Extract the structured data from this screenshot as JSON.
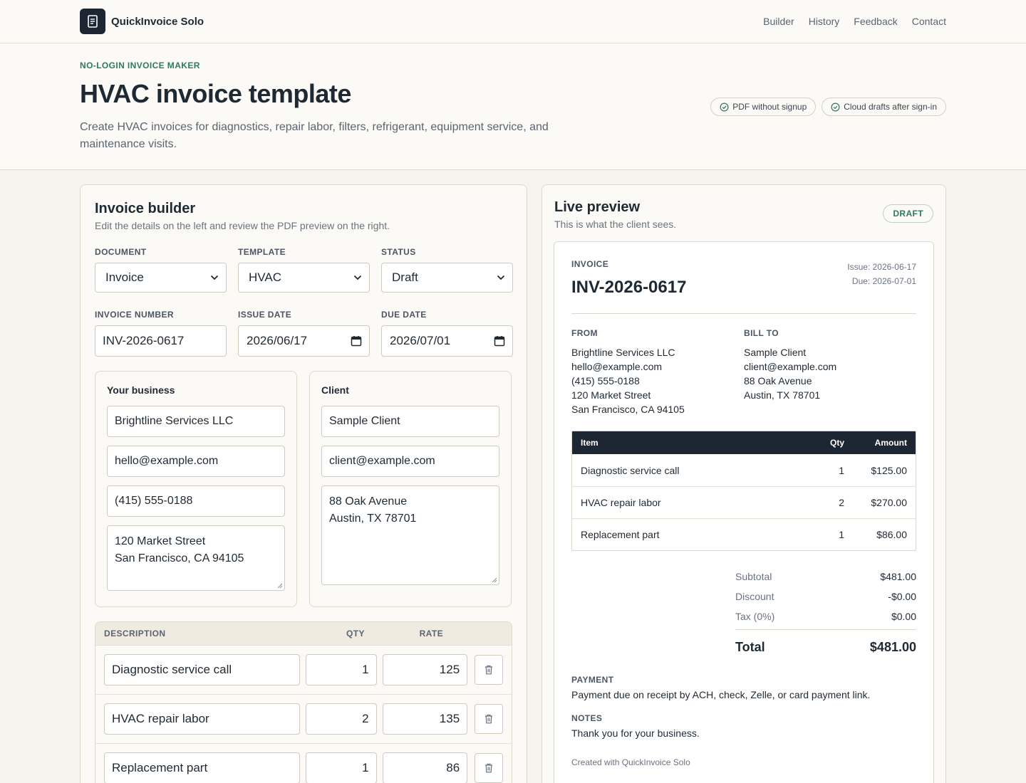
{
  "app": {
    "name": "QuickInvoice Solo"
  },
  "nav": [
    {
      "label": "Builder"
    },
    {
      "label": "History"
    },
    {
      "label": "Feedback"
    },
    {
      "label": "Contact"
    }
  ],
  "hero": {
    "eyebrow": "NO-LOGIN INVOICE MAKER",
    "title": "HVAC invoice template",
    "description": "Create HVAC invoices for diagnostics, repair labor, filters, refrigerant, equipment service, and maintenance visits.",
    "badges": [
      {
        "label": "PDF without signup",
        "icon": "check-circle-icon"
      },
      {
        "label": "Cloud drafts after sign-in",
        "icon": "check-circle-icon"
      }
    ]
  },
  "builder": {
    "title": "Invoice builder",
    "subtitle": "Edit the details on the left and review the PDF preview on the right.",
    "document": {
      "label": "DOCUMENT",
      "value": "Invoice"
    },
    "template": {
      "label": "TEMPLATE",
      "value": "HVAC"
    },
    "status": {
      "label": "STATUS",
      "value": "Draft"
    },
    "invoice_number": {
      "label": "INVOICE NUMBER",
      "value": "INV-2026-0617"
    },
    "issue_date": {
      "label": "ISSUE DATE",
      "value": "2026/06/17"
    },
    "due_date": {
      "label": "DUE DATE",
      "value": "2026/07/01"
    },
    "business": {
      "title": "Your business",
      "name": "Brightline Services LLC",
      "email": "hello@example.com",
      "phone": "(415) 555-0188",
      "address_line1": "120 Market Street",
      "address_line2": "San Francisco, CA 94105"
    },
    "client": {
      "title": "Client",
      "name": "Sample Client",
      "email": "client@example.com",
      "address_line1": "88 Oak Avenue",
      "address_line2": "Austin, TX 78701"
    },
    "items_header": {
      "description": "DESCRIPTION",
      "qty": "QTY",
      "rate": "RATE"
    },
    "items": [
      {
        "description": "Diagnostic service call",
        "qty": "1",
        "rate": "125"
      },
      {
        "description": "HVAC repair labor",
        "qty": "2",
        "rate": "135"
      },
      {
        "description": "Replacement part",
        "qty": "1",
        "rate": "86"
      }
    ]
  },
  "preview": {
    "title": "Live preview",
    "subtitle": "This is what the client sees.",
    "status_badge": "DRAFT",
    "invoice_label": "INVOICE",
    "invoice_number": "INV-2026-0617",
    "issue": "Issue: 2026-06-17",
    "due": "Due: 2026-07-01",
    "from_label": "FROM",
    "from": [
      "Brightline Services LLC",
      "hello@example.com",
      "(415) 555-0188",
      "120 Market Street",
      "San Francisco, CA 94105"
    ],
    "bill_to_label": "BILL TO",
    "bill_to": [
      "Sample Client",
      "client@example.com",
      "88 Oak Avenue",
      "Austin, TX 78701"
    ],
    "table_header": {
      "item": "Item",
      "qty": "Qty",
      "amount": "Amount"
    },
    "rows": [
      {
        "item": "Diagnostic service call",
        "qty": "1",
        "amount": "$125.00"
      },
      {
        "item": "HVAC repair labor",
        "qty": "2",
        "amount": "$270.00"
      },
      {
        "item": "Replacement part",
        "qty": "1",
        "amount": "$86.00"
      }
    ],
    "subtotal_label": "Subtotal",
    "subtotal": "$481.00",
    "discount_label": "Discount",
    "discount": "-$0.00",
    "tax_label": "Tax (0%)",
    "tax": "$0.00",
    "total_label": "Total",
    "total": "$481.00",
    "payment_label": "PAYMENT",
    "payment": "Payment due on receipt by ACH, check, Zelle, or card payment link.",
    "notes_label": "NOTES",
    "notes": "Thank you for your business.",
    "footer": "Created with QuickInvoice Solo"
  },
  "colors": {
    "accent": "#2e7a5b",
    "dark": "#1d2733",
    "background": "#f6f4ec"
  }
}
